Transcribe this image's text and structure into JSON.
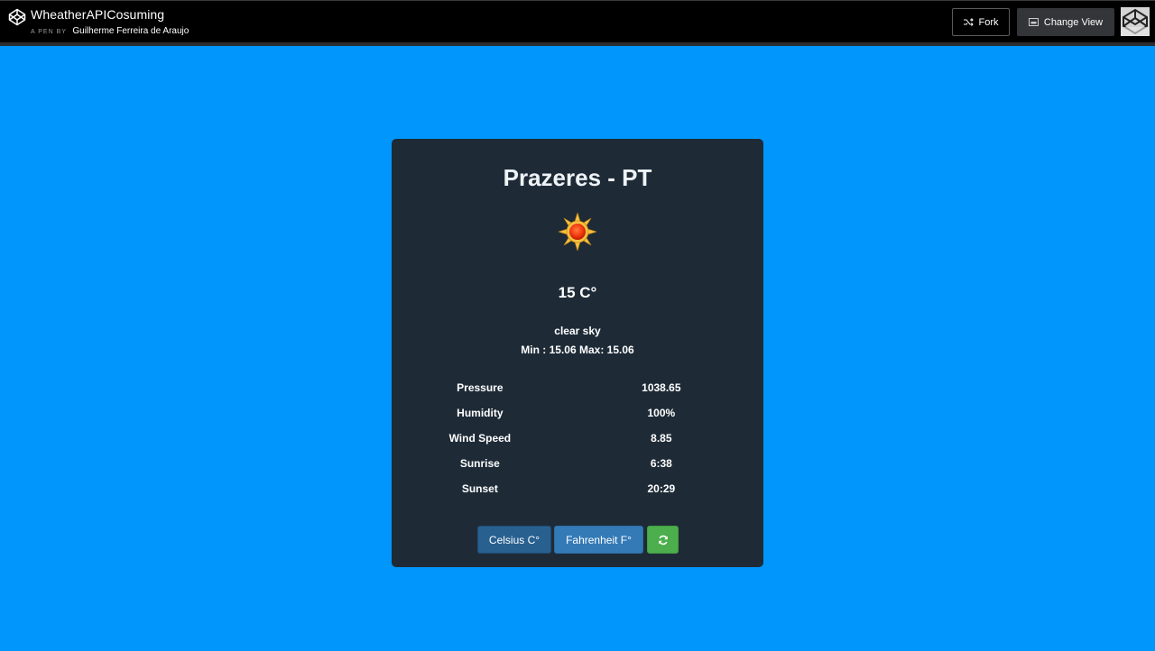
{
  "topbar": {
    "pen_title": "WheatherAPICosuming",
    "pen_by_label": "A PEN BY",
    "author": "Guilherme Ferreira de Araujo",
    "fork_label": "Fork",
    "change_view_label": "Change View",
    "icons": {
      "logo": "codepen-logo-icon",
      "fork": "fork-icon",
      "change_view": "layout-icon",
      "avatar": "avatar"
    }
  },
  "weather": {
    "location": "Prazeres - PT",
    "icon": "sun-icon",
    "temperature": "15 C°",
    "description": "clear sky",
    "min_max": "Min : 15.06 Max: 15.06",
    "stats": [
      {
        "label": "Pressure",
        "value": "1038.65"
      },
      {
        "label": "Humidity",
        "value": "100%"
      },
      {
        "label": "Wind Speed",
        "value": "8.85"
      },
      {
        "label": "Sunrise",
        "value": "6:38"
      },
      {
        "label": "Sunset",
        "value": "20:29"
      }
    ],
    "buttons": {
      "celsius": "Celsius C°",
      "fahrenheit": "Fahrenheit F°",
      "refresh_icon": "refresh-icon"
    }
  },
  "colors": {
    "background": "#0096fb",
    "card": "#1e2b37",
    "btn_celsius": "#286090",
    "btn_fahrenheit": "#337ab7",
    "btn_refresh": "#4cae4c"
  }
}
